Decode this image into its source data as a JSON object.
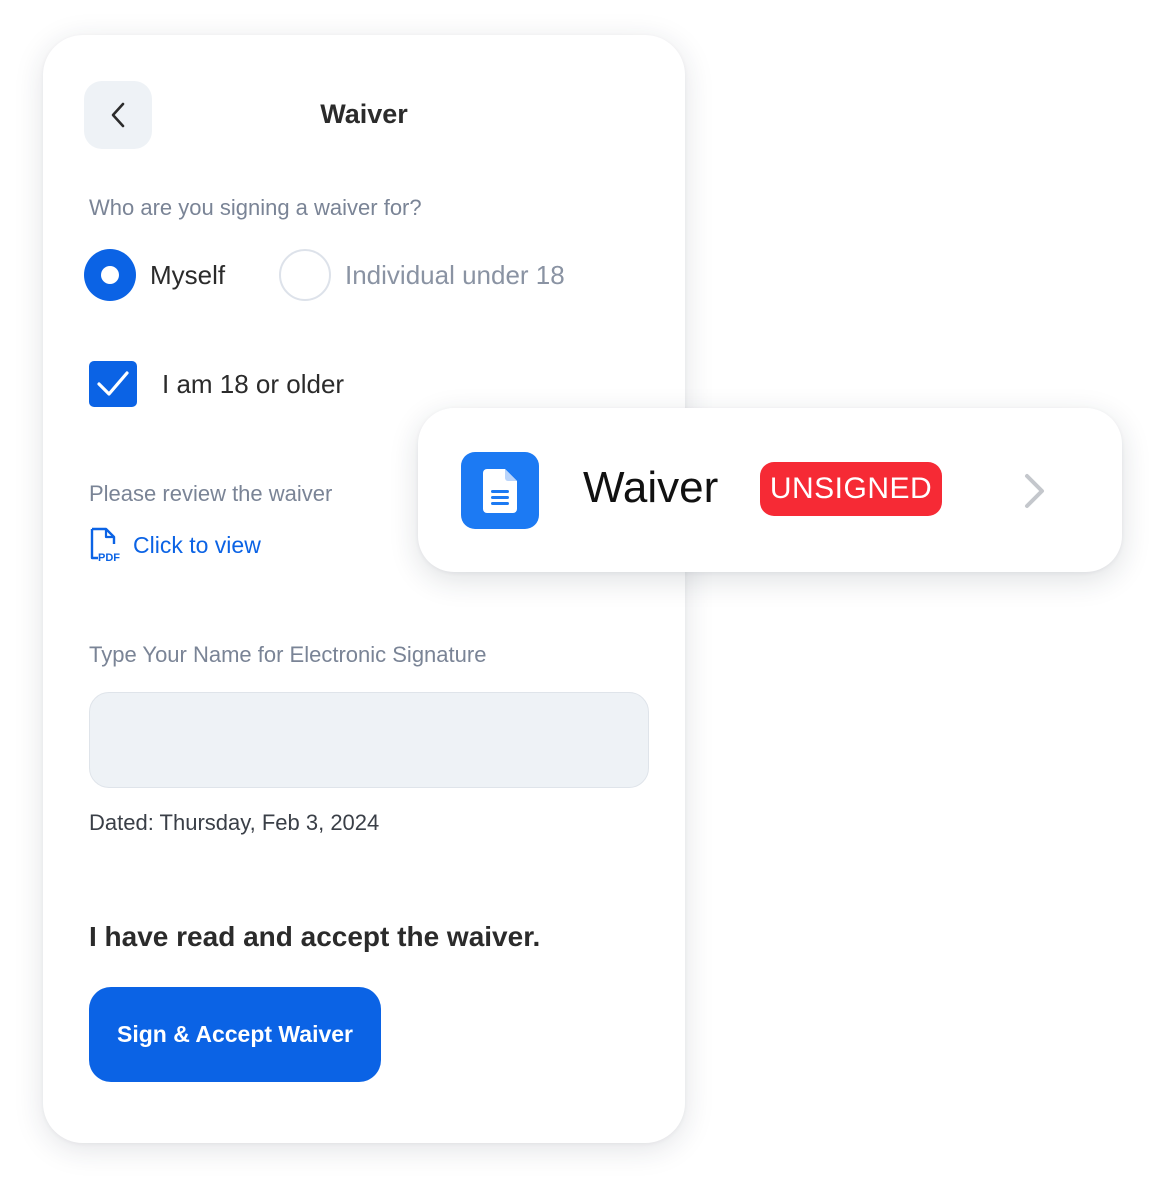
{
  "header": {
    "title": "Waiver",
    "back_icon": "chevron-left-icon"
  },
  "signer": {
    "question": "Who are you signing a waiver for?",
    "options": [
      {
        "label": "Myself",
        "selected": true
      },
      {
        "label": "Individual under 18",
        "selected": false
      }
    ]
  },
  "age_confirm": {
    "label": "I am 18 or older",
    "checked": true
  },
  "review": {
    "label": "Please review the waiver",
    "link_label": "Click to view",
    "icon": "pdf-file-icon",
    "icon_text": "PDF"
  },
  "signature": {
    "label": "Type Your Name for Electronic Signature",
    "value": "",
    "placeholder": ""
  },
  "dated": "Dated: Thursday, Feb 3, 2024",
  "accept_text": "I have read and accept the waiver.",
  "sign_button": "Sign & Accept Waiver",
  "waiver_card": {
    "title": "Waiver",
    "status": "UNSIGNED",
    "icon": "document-icon",
    "chevron_icon": "chevron-right-icon"
  },
  "colors": {
    "primary": "#0b63e5",
    "doc_tile": "#1c7af3",
    "unsigned_badge": "#f62a35",
    "field_background": "#eef2f6",
    "muted_text": "#7a8496"
  }
}
